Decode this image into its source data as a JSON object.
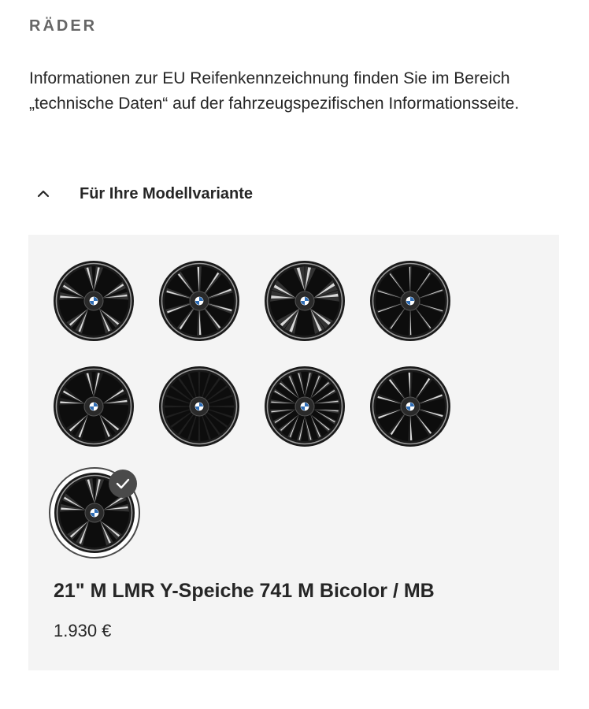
{
  "section": {
    "title": "RÄDER"
  },
  "info": {
    "text": "Informationen zur EU Reifenkennzeichnung finden Sie im Bereich „technische Daten“ auf der fahrzeugspezifischen Informationsseite."
  },
  "accordion": {
    "label": "Für Ihre Modellvariante",
    "expanded": true,
    "icon": "chevron-up-icon"
  },
  "wheels": {
    "options_count": 9,
    "selected_index": 8,
    "selected_icon": "checkmark-icon"
  },
  "selected_wheel": {
    "name": "21\" M LMR Y-Speiche 741 M Bicolor / MB",
    "price": "1.930 €"
  },
  "colors": {
    "panel_background": "#f4f4f4",
    "text": "#262626",
    "heading_muted": "#666666",
    "selected_accent": "#4a4a4a"
  }
}
